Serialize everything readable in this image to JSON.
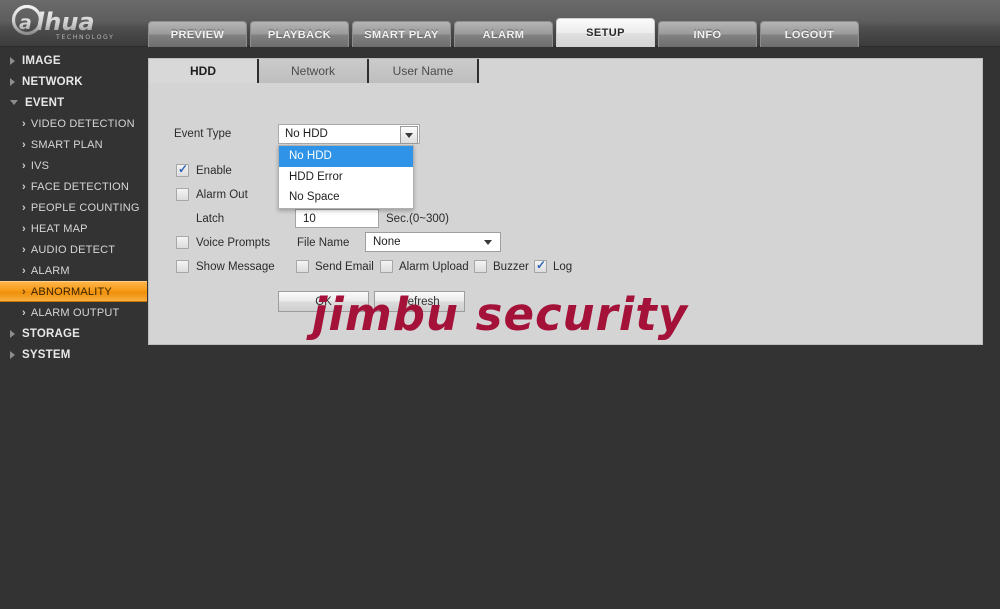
{
  "brand": {
    "name": "alhua",
    "tagline": "TECHNOLOGY"
  },
  "nav": {
    "tabs": [
      {
        "label": "PREVIEW",
        "active": false
      },
      {
        "label": "PLAYBACK",
        "active": false
      },
      {
        "label": "SMART PLAY",
        "active": false
      },
      {
        "label": "ALARM",
        "active": false
      },
      {
        "label": "SETUP",
        "active": true
      },
      {
        "label": "INFO",
        "active": false
      },
      {
        "label": "LOGOUT",
        "active": false
      }
    ]
  },
  "sidebar": {
    "groups": [
      {
        "label": "IMAGE",
        "expanded": false
      },
      {
        "label": "NETWORK",
        "expanded": false
      },
      {
        "label": "EVENT",
        "expanded": true
      },
      {
        "label": "STORAGE",
        "expanded": false
      },
      {
        "label": "SYSTEM",
        "expanded": false
      }
    ],
    "event_children": [
      {
        "label": "VIDEO DETECTION",
        "selected": false
      },
      {
        "label": "SMART PLAN",
        "selected": false
      },
      {
        "label": "IVS",
        "selected": false
      },
      {
        "label": "FACE DETECTION",
        "selected": false
      },
      {
        "label": "PEOPLE COUNTING",
        "selected": false
      },
      {
        "label": "HEAT MAP",
        "selected": false
      },
      {
        "label": "AUDIO DETECT",
        "selected": false
      },
      {
        "label": "ALARM",
        "selected": false
      },
      {
        "label": "ABNORMALITY",
        "selected": true
      },
      {
        "label": "ALARM OUTPUT",
        "selected": false
      }
    ]
  },
  "content": {
    "tabs": [
      {
        "label": "HDD",
        "active": true
      },
      {
        "label": "Network",
        "active": false
      },
      {
        "label": "User Name",
        "active": false
      }
    ]
  },
  "form": {
    "event_type_label": "Event Type",
    "event_type_value": "No HDD",
    "event_type_options": [
      {
        "label": "No HDD",
        "highlighted": true
      },
      {
        "label": "HDD Error",
        "highlighted": false
      },
      {
        "label": "No Space",
        "highlighted": false
      }
    ],
    "enable_label": "Enable",
    "enable_checked": true,
    "alarm_out_label": "Alarm Out",
    "alarm_out_checked": false,
    "latch_label": "Latch",
    "latch_value": "10",
    "latch_unit": "Sec.(0~300)",
    "voice_prompts_label": "Voice Prompts",
    "voice_prompts_checked": false,
    "file_name_label": "File Name",
    "file_name_value": "None",
    "show_message_label": "Show Message",
    "show_message_checked": false,
    "send_email_label": "Send Email",
    "send_email_checked": false,
    "alarm_upload_label": "Alarm Upload",
    "alarm_upload_checked": false,
    "buzzer_label": "Buzzer",
    "buzzer_checked": false,
    "log_label": "Log",
    "log_checked": true,
    "ok_label": "OK",
    "refresh_label": "Refresh"
  },
  "watermark": {
    "text": "jimbu security",
    "color": "#a4123a"
  },
  "colors": {
    "accent_orange": "#f59a16",
    "dropdown_highlight": "#2f93e8",
    "panel_bg": "#d4d4d4",
    "page_bg": "#333333"
  }
}
